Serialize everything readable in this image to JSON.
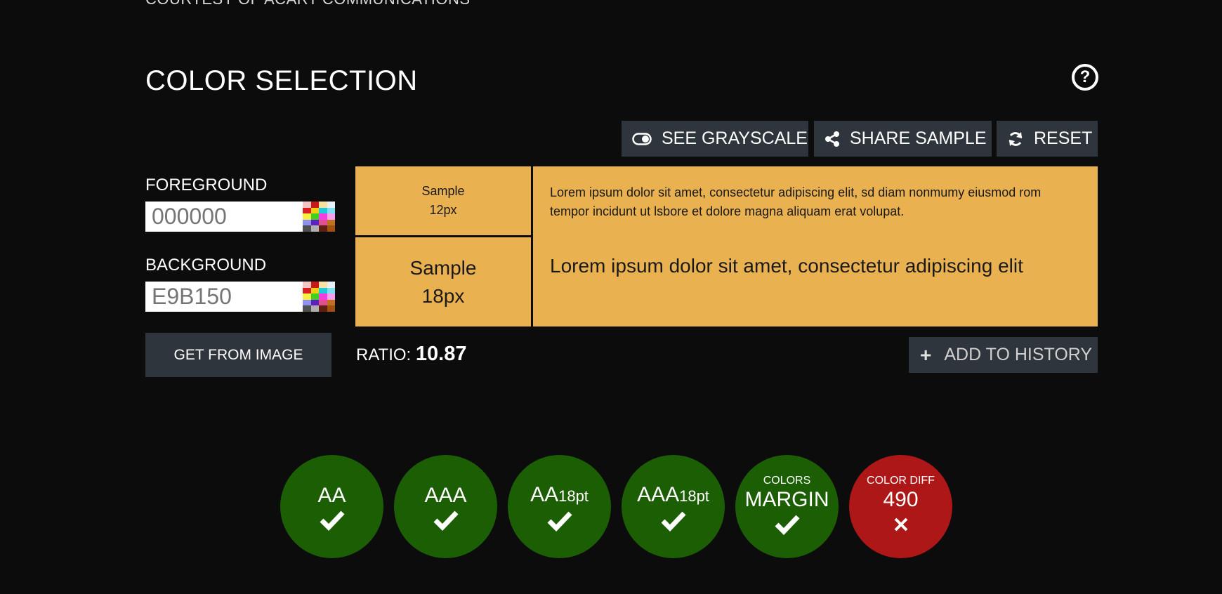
{
  "header": {
    "courtesy": "COURTESY OF ACART COMMUNICATIONS",
    "title": "COLOR SELECTION",
    "help_icon": "question-circle-icon",
    "help_symbol": "?"
  },
  "toolbar": {
    "grayscale_label": "SEE GRAYSCALE",
    "share_label": "SHARE SAMPLE",
    "reset_label": "RESET"
  },
  "foreground": {
    "label": "FOREGROUND",
    "placeholder": "000000",
    "value": ""
  },
  "background": {
    "label": "BACKGROUND",
    "placeholder": "E9B150",
    "value": ""
  },
  "get_from_image_label": "GET FROM IMAGE",
  "sample": {
    "background_color": "#e9b150",
    "small_label": "Sample",
    "small_size": "12px",
    "large_label": "Sample",
    "large_size": "18px",
    "small_text": "Lorem ipsum dolor sit amet, consectetur adipiscing elit, sd diam nonmumy eiusmod rom tempor incidunt ut lsbore et dolore magna aliquam erat volupat.",
    "large_text": "Lorem ipsum dolor sit amet, consectetur adipiscing elit"
  },
  "ratio": {
    "label": "RATIO:",
    "value": "10.87"
  },
  "add_history_label": "ADD TO HISTORY",
  "results": {
    "pass_color": "#1c5e04",
    "fail_color": "#ae1717",
    "aa": {
      "main": "AA",
      "status": "pass"
    },
    "aaa": {
      "main": "AAA",
      "status": "pass"
    },
    "aa18": {
      "main": "AA",
      "sub": "18pt",
      "status": "pass"
    },
    "aaa18": {
      "main": "AAA",
      "sub": "18pt",
      "status": "pass"
    },
    "margin": {
      "top": "COLORS",
      "main": "MARGIN",
      "status": "pass"
    },
    "diff": {
      "top": "COLOR DIFF",
      "main": "490",
      "status": "fail"
    }
  }
}
